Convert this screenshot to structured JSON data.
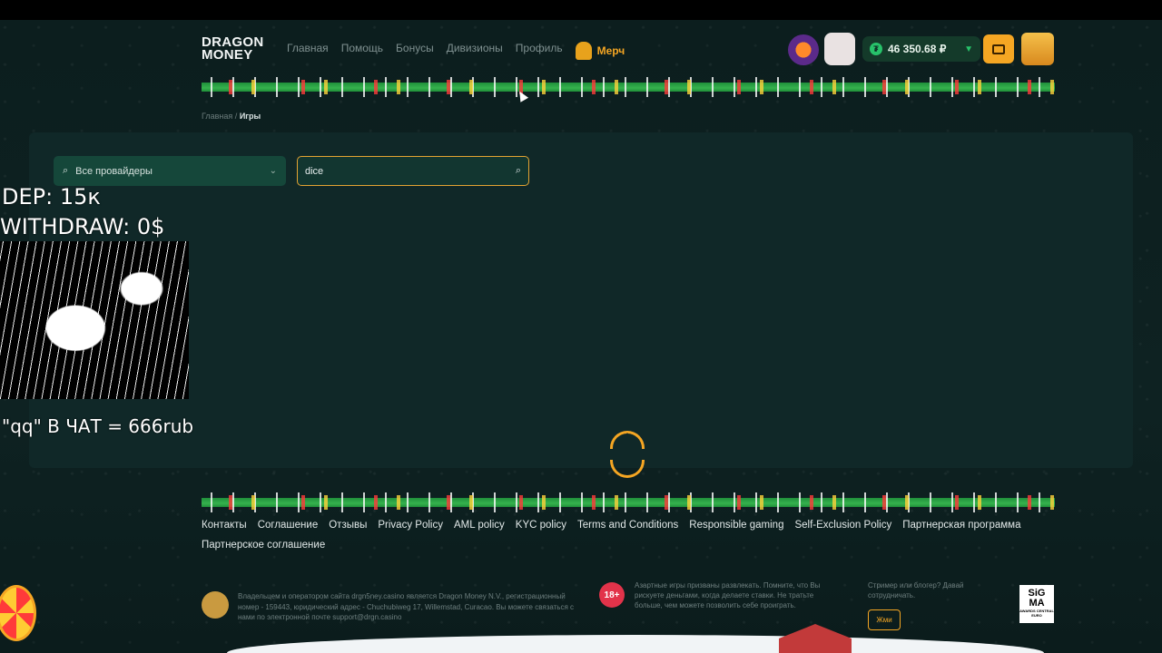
{
  "header": {
    "logo_line1": "DRAGON",
    "logo_line2": "MONEY",
    "nav": [
      "Главная",
      "Помощь",
      "Бонусы",
      "Дивизионы",
      "Профиль"
    ],
    "merch_label": "Мерч",
    "balance": "46 350.68 ₽",
    "balance_currency_icon": "₮"
  },
  "breadcrumb": {
    "home": "Главная",
    "separator": "/",
    "current": "Игры"
  },
  "filters": {
    "provider_value": "Все провайдеры",
    "search_value": "dice"
  },
  "overlay": {
    "dep": "DEP: 15к",
    "withdraw": "WITHDRAW: 0$",
    "chat": "\"qq\" В ЧАТ =  666rub"
  },
  "footer": {
    "links": [
      "Контакты",
      "Соглашение",
      "Отзывы",
      "Privacy Policy",
      "AML policy",
      "KYC policy",
      "Terms and Conditions",
      "Responsible gaming",
      "Self-Exclusion Policy",
      "Партнерская программа",
      "Партнерское соглашение"
    ],
    "legal_text": "Владельцем и оператором сайта drgn5ney.casino является Dragon Money N.V., регистрационный номер - 159443, юридический адрес - Chuchubiweg 17, Willemstad, Curacao. Вы можете связаться с нами по электронной почте support@drgn.casino",
    "age_badge": "18+",
    "warning_text": "Азартные игры призваны развлекать. Помните, что Вы рискуете деньгами, когда делаете ставки. Не тратьте больше, чем можете позволить себе проиграть.",
    "streamer_text": "Стример или блогер? Давай сотрудничать.",
    "write_button": "Жми",
    "sigma_line1": "SiG",
    "sigma_line2": "MA",
    "sigma_sub": "AWARDS CENTRAL EURO"
  },
  "colors": {
    "accent": "#f5a623",
    "green": "#27c26a",
    "background": "#0b1d1d"
  }
}
